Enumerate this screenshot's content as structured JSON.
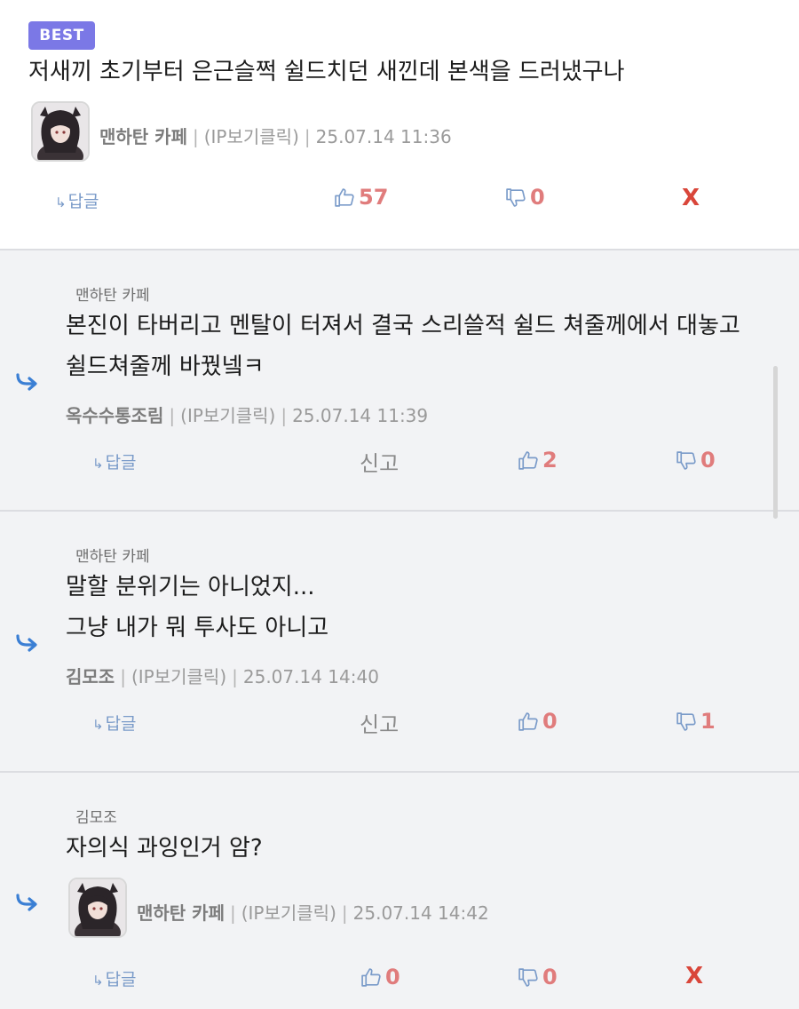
{
  "best_comment": {
    "badge": "BEST",
    "content": "저새끼 초기부터 은근슬쩍 쉴드치던 새낀데 본색을 드러냈구나",
    "author": "맨하탄 카페",
    "ip": "(IP보기클릭)",
    "datetime": "25.07.14 11:36",
    "reply_label": "답글",
    "up_count": "57",
    "down_count": "0",
    "delete_label": "X"
  },
  "replies": [
    {
      "parent": "맨하탄 카페",
      "lines": [
        "본진이 타버리고 멘탈이 터져서 결국 스리쓸적 쉴드 쳐줄께에서 대놓고",
        "쉴드쳐줄께 바꿨넼ㅋ"
      ],
      "author": "옥수수통조림",
      "ip": "(IP보기클릭)",
      "datetime": "25.07.14 11:39",
      "reply_label": "답글",
      "report_label": "신고",
      "up_count": "2",
      "down_count": "0"
    },
    {
      "parent": "맨하탄 카페",
      "lines": [
        "말할 분위기는 아니었지...",
        "그냥 내가 뭐 투사도 아니고"
      ],
      "author": "김모조",
      "ip": "(IP보기클릭)",
      "datetime": "25.07.14 14:40",
      "reply_label": "답글",
      "report_label": "신고",
      "up_count": "0",
      "down_count": "1"
    },
    {
      "parent": "김모조",
      "lines": [
        "자의식 과잉인거 암?"
      ],
      "author": "맨하탄 카페",
      "ip": "(IP보기클릭)",
      "datetime": "25.07.14 14:42",
      "reply_label": "답글",
      "up_count": "0",
      "down_count": "0",
      "delete_label": "X"
    }
  ],
  "icons": {
    "reply_arrow": "reply-arrow-icon",
    "thumb_up": "thumbs-up-icon",
    "thumb_down": "thumbs-down-icon"
  },
  "colors": {
    "best_badge": "#7b78e6",
    "vote_count": "#e07c7c",
    "delete": "#d9463a",
    "reply_link": "#7a9bc9",
    "reply_arrow": "#3b7fd4"
  }
}
